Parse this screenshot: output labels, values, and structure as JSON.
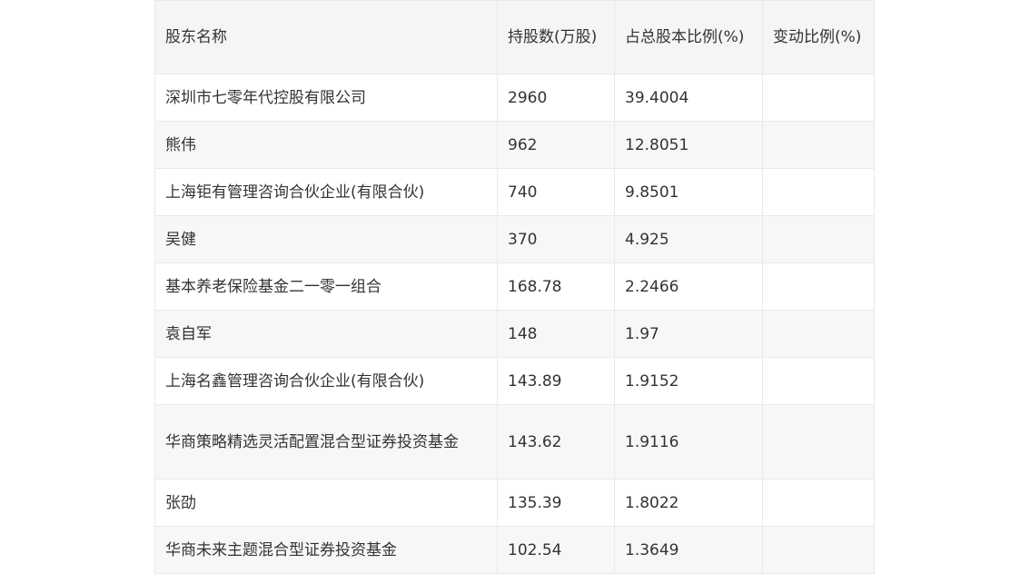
{
  "table": {
    "headers": [
      "股东名称",
      "持股数(万股)",
      "占总股本比例(%)",
      "变动比例(%)"
    ],
    "rows": [
      {
        "name": "深圳市七零年代控股有限公司",
        "shares": "2960",
        "ratio": "39.4004",
        "change": ""
      },
      {
        "name": "熊伟",
        "shares": "962",
        "ratio": "12.8051",
        "change": ""
      },
      {
        "name": "上海钜有管理咨询合伙企业(有限合伙)",
        "shares": "740",
        "ratio": "9.8501",
        "change": ""
      },
      {
        "name": "吴健",
        "shares": "370",
        "ratio": "4.925",
        "change": ""
      },
      {
        "name": "基本养老保险基金二一零一组合",
        "shares": "168.78",
        "ratio": "2.2466",
        "change": ""
      },
      {
        "name": "袁自军",
        "shares": "148",
        "ratio": "1.97",
        "change": ""
      },
      {
        "name": "上海名鑫管理咨询合伙企业(有限合伙)",
        "shares": "143.89",
        "ratio": "1.9152",
        "change": ""
      },
      {
        "name": "华商策略精选灵活配置混合型证券投资基金",
        "shares": "143.62",
        "ratio": "1.9116",
        "change": ""
      },
      {
        "name": "张劭",
        "shares": "135.39",
        "ratio": "1.8022",
        "change": ""
      },
      {
        "name": "华商未来主题混合型证券投资基金",
        "shares": "102.54",
        "ratio": "1.3649",
        "change": ""
      }
    ]
  }
}
